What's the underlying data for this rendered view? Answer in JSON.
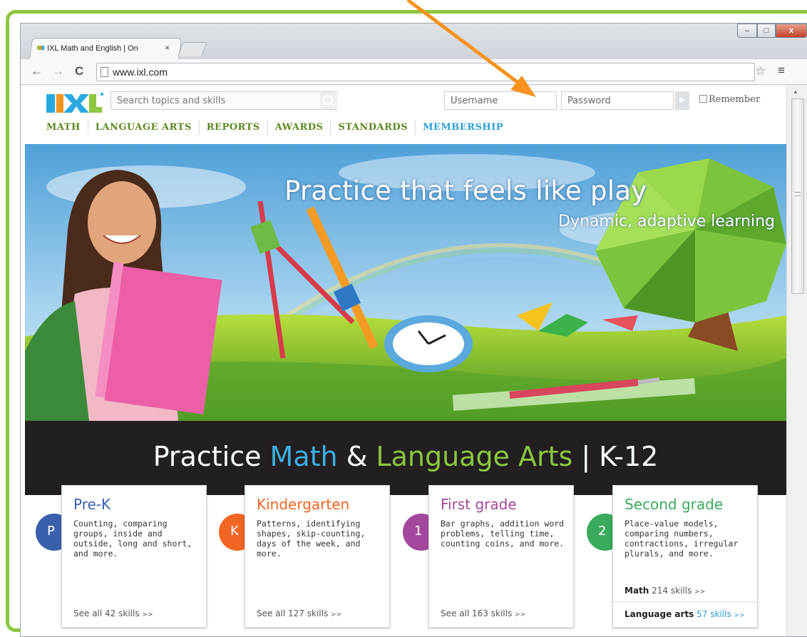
{
  "browser": {
    "tab_title": "IXL Math and English | On",
    "tab_close": "×",
    "url": "www.ixl.com",
    "window_controls": [
      "–",
      "□",
      "x"
    ]
  },
  "header": {
    "logo_text": "IXL",
    "search_placeholder": "Search topics and skills",
    "username_placeholder": "Username",
    "password_placeholder": "Password",
    "remember_label": "Remember",
    "nav": [
      "MATH",
      "LANGUAGE ARTS",
      "REPORTS",
      "AWARDS",
      "STANDARDS",
      "MEMBERSHIP"
    ]
  },
  "hero": {
    "title": "Practice that feels like play",
    "subtitle": "Dynamic, adaptive learning"
  },
  "band": {
    "prefix": "Practice ",
    "math": "Math",
    "amp": " & ",
    "la": "Language Arts",
    "suffix": " | K-12"
  },
  "grades": [
    {
      "badge": "P",
      "title": "Pre-K",
      "desc": "Counting, comparing groups, inside and outside, long and short, and more.",
      "see_all": "See all 42 skills",
      "color": "#3a5fad"
    },
    {
      "badge": "K",
      "title": "Kindergarten",
      "desc": "Patterns, identifying shapes, skip-counting, days of the week, and more.",
      "see_all": "See all 127 skills",
      "color": "#f26522"
    },
    {
      "badge": "1",
      "title": "First grade",
      "desc": "Bar graphs, addition word problems, telling time, counting coins, and more.",
      "see_all": "See all 163 skills",
      "color": "#a3479c"
    },
    {
      "badge": "2",
      "title": "Second grade",
      "desc": "Place-value models, comparing numbers, contractions, irregular plurals, and more.",
      "math_label": "Math",
      "math_count": "214 skills",
      "la_label": "Language arts",
      "la_count": "57 skills",
      "color": "#3aaa5c"
    }
  ],
  "more_arrows": ">>",
  "colors": {
    "frame": "#8dc63f",
    "arrow": "#f7931e",
    "nav": "#5a8a1f",
    "membership": "#2a9fd8"
  }
}
